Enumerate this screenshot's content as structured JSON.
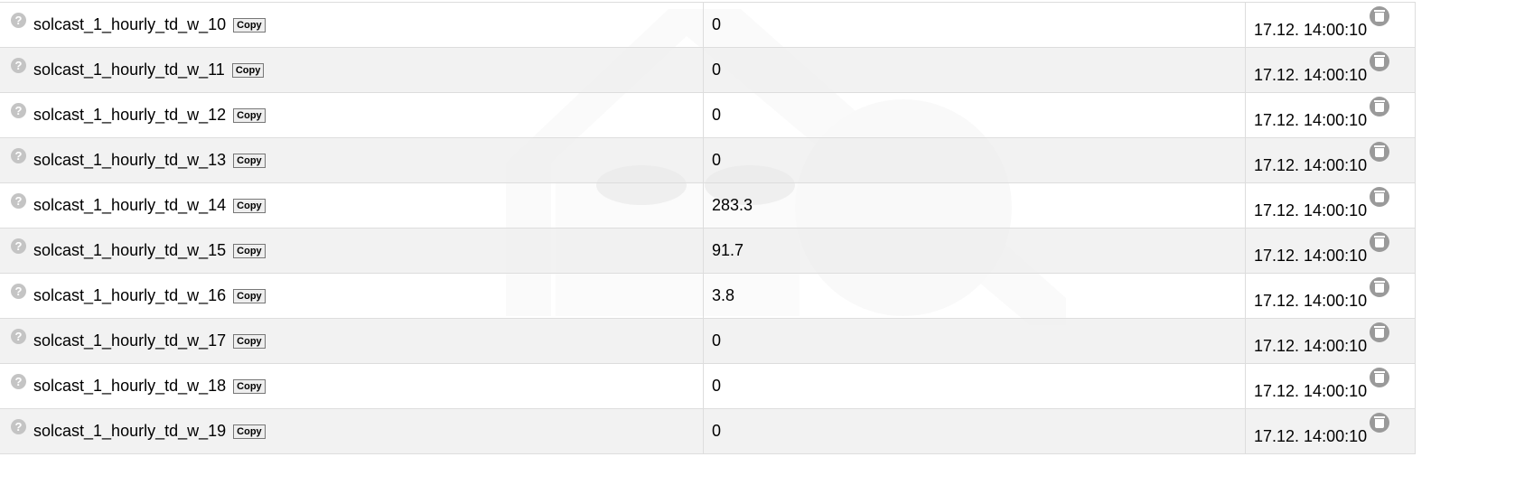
{
  "copy_label": "Copy",
  "rows": [
    {
      "name": "solcast_1_hourly_td_w_10",
      "value": "0",
      "time": "17.12. 14:00:10"
    },
    {
      "name": "solcast_1_hourly_td_w_11",
      "value": "0",
      "time": "17.12. 14:00:10"
    },
    {
      "name": "solcast_1_hourly_td_w_12",
      "value": "0",
      "time": "17.12. 14:00:10"
    },
    {
      "name": "solcast_1_hourly_td_w_13",
      "value": "0",
      "time": "17.12. 14:00:10"
    },
    {
      "name": "solcast_1_hourly_td_w_14",
      "value": "283.3",
      "time": "17.12. 14:00:10"
    },
    {
      "name": "solcast_1_hourly_td_w_15",
      "value": "91.7",
      "time": "17.12. 14:00:10"
    },
    {
      "name": "solcast_1_hourly_td_w_16",
      "value": "3.8",
      "time": "17.12. 14:00:10"
    },
    {
      "name": "solcast_1_hourly_td_w_17",
      "value": "0",
      "time": "17.12. 14:00:10"
    },
    {
      "name": "solcast_1_hourly_td_w_18",
      "value": "0",
      "time": "17.12. 14:00:10"
    },
    {
      "name": "solcast_1_hourly_td_w_19",
      "value": "0",
      "time": "17.12. 14:00:10"
    }
  ],
  "icons": {
    "help": "question-circle-icon",
    "delete": "trash-icon"
  }
}
